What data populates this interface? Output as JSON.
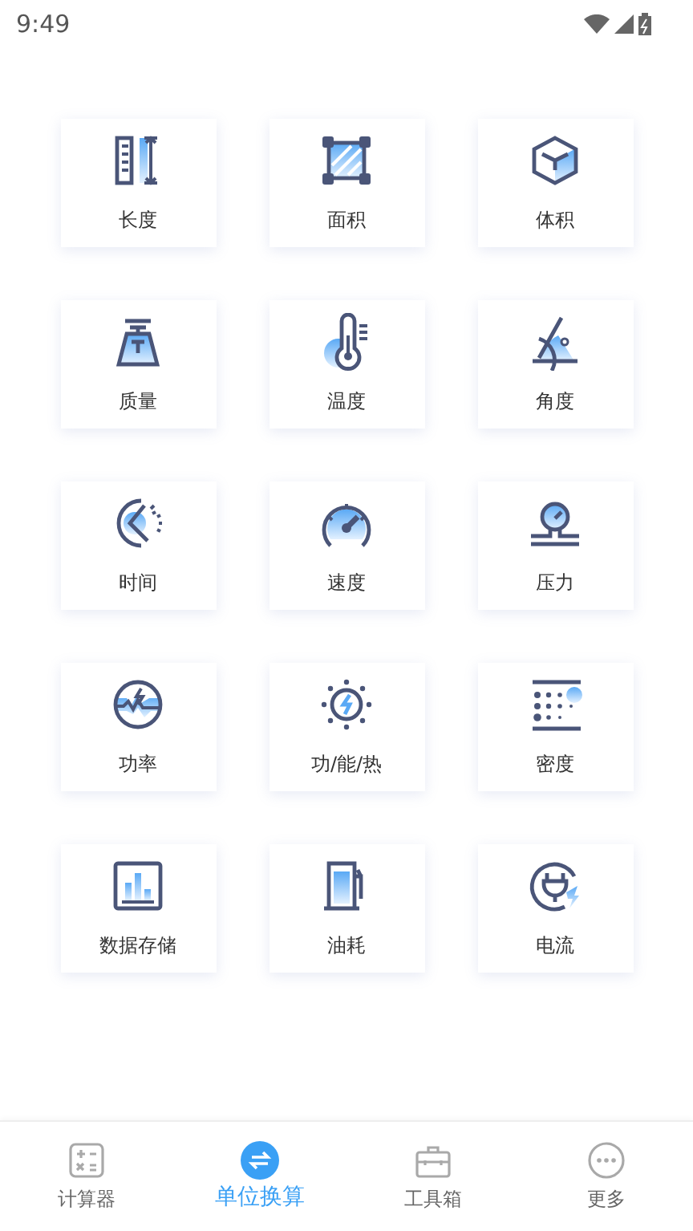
{
  "status_bar": {
    "time": "9:49"
  },
  "units": [
    {
      "label": "长度"
    },
    {
      "label": "面积"
    },
    {
      "label": "体积"
    },
    {
      "label": "质量"
    },
    {
      "label": "温度"
    },
    {
      "label": "角度"
    },
    {
      "label": "时间"
    },
    {
      "label": "速度"
    },
    {
      "label": "压力"
    },
    {
      "label": "功率"
    },
    {
      "label": "功/能/热"
    },
    {
      "label": "密度"
    },
    {
      "label": "数据存储"
    },
    {
      "label": "油耗"
    },
    {
      "label": "电流"
    }
  ],
  "tab_bar": [
    {
      "label": "计算器",
      "selected": false
    },
    {
      "label": "单位换算",
      "selected": true
    },
    {
      "label": "工具箱",
      "selected": false
    },
    {
      "label": "更多",
      "selected": false
    }
  ]
}
